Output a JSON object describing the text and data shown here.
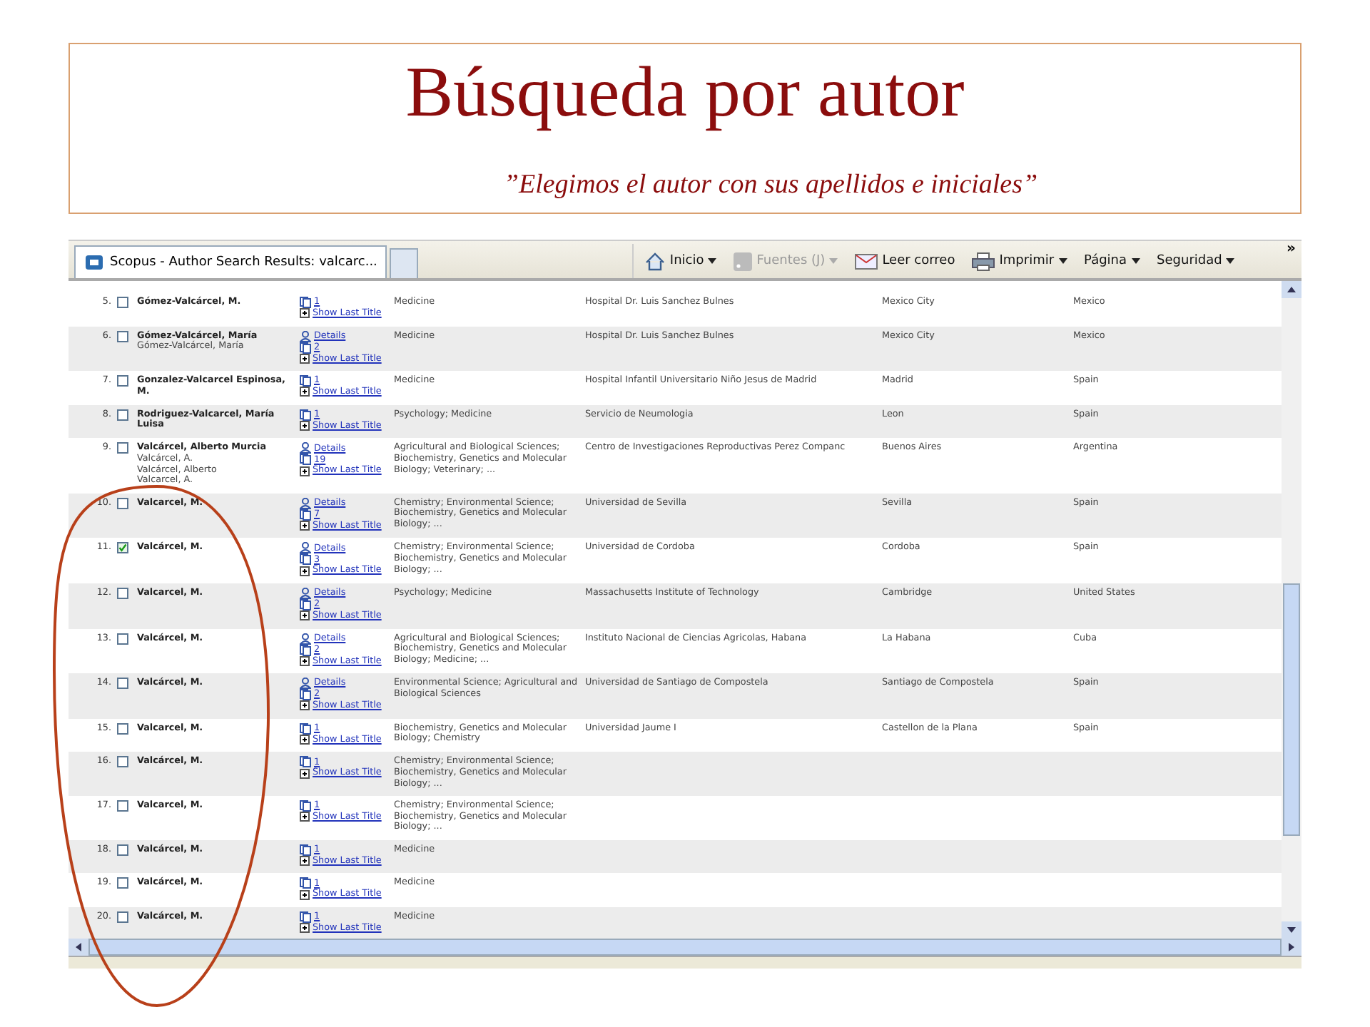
{
  "slide": {
    "title": "Búsqueda por autor",
    "subtitle": "”Elegimos el autor con sus apellidos e iniciales”"
  },
  "browser": {
    "tab": "Scopus - Author Search Results: valcarc...",
    "toolbar": [
      {
        "label": "Inicio",
        "kind": "home",
        "dropdown": true,
        "disabled": false
      },
      {
        "label": "Fuentes (J)",
        "kind": "feed",
        "dropdown": true,
        "disabled": true
      },
      {
        "label": "Leer correo",
        "kind": "mail",
        "dropdown": false,
        "disabled": false
      },
      {
        "label": "Imprimir",
        "kind": "print",
        "dropdown": true,
        "disabled": false
      },
      {
        "label": "Página",
        "kind": "text",
        "dropdown": true,
        "disabled": false
      },
      {
        "label": "Seguridad",
        "kind": "text",
        "dropdown": true,
        "disabled": false
      }
    ],
    "overflow": "»"
  },
  "rows": [
    {
      "number": "5.",
      "checked": false,
      "name": "Gómez-Valcárcel, M.",
      "variants": [],
      "details": "",
      "documents": "1",
      "show_last_title": "Show Last Title",
      "subjects": "Medicine",
      "affiliation": "Hospital Dr. Luis Sanchez Bulnes",
      "city": "Mexico City",
      "country": "Mexico"
    },
    {
      "number": "6.",
      "checked": false,
      "name": "Gómez-Valcárcel, María",
      "variants": [
        "Gómez-Valcárcel, María"
      ],
      "details": "Details",
      "documents": "2",
      "show_last_title": "Show Last Title",
      "subjects": "Medicine",
      "affiliation": "Hospital Dr. Luis Sanchez Bulnes",
      "city": "Mexico City",
      "country": "Mexico"
    },
    {
      "number": "7.",
      "checked": false,
      "name": "Gonzalez-Valcarcel Espinosa, M.",
      "variants": [],
      "details": "",
      "documents": "1",
      "show_last_title": "Show Last Title",
      "subjects": "Medicine",
      "affiliation": "Hospital Infantil Universitario Niño Jesus de Madrid",
      "city": "Madrid",
      "country": "Spain"
    },
    {
      "number": "8.",
      "checked": false,
      "name": "Rodriguez-Valcarcel, María Luisa",
      "variants": [],
      "details": "",
      "documents": "1",
      "show_last_title": "Show Last Title",
      "subjects": "Psychology; Medicine",
      "affiliation": "Servicio de Neumologia",
      "city": "Leon",
      "country": "Spain"
    },
    {
      "number": "9.",
      "checked": false,
      "name": "Valcárcel, Alberto Murcia",
      "variants": [
        "Valcárcel, A.",
        "Valcárcel, Alberto",
        "Valcarcel, A."
      ],
      "details": "Details",
      "documents": "19",
      "show_last_title": "Show Last Title",
      "subjects": "Agricultural and Biological Sciences; Biochemistry, Genetics and Molecular Biology; Veterinary; ...",
      "affiliation": "Centro de Investigaciones Reproductivas Perez Companc",
      "city": "Buenos Aires",
      "country": "Argentina"
    },
    {
      "number": "10.",
      "checked": false,
      "name": "Valcarcel, M.",
      "variants": [],
      "details": "Details",
      "documents": "7",
      "show_last_title": "Show Last Title",
      "subjects": "Chemistry; Environmental Science; Biochemistry, Genetics and Molecular Biology; ...",
      "affiliation": "Universidad de Sevilla",
      "city": "Sevilla",
      "country": "Spain"
    },
    {
      "number": "11.",
      "checked": true,
      "name": "Valcárcel, M.",
      "variants": [],
      "details": "Details",
      "documents": "3",
      "show_last_title": "Show Last Title",
      "subjects": "Chemistry; Environmental Science; Biochemistry, Genetics and Molecular Biology; ...",
      "affiliation": "Universidad de Cordoba",
      "city": "Cordoba",
      "country": "Spain"
    },
    {
      "number": "12.",
      "checked": false,
      "name": "Valcarcel, M.",
      "variants": [],
      "details": "Details",
      "documents": "2",
      "show_last_title": "Show Last Title",
      "subjects": "Psychology; Medicine",
      "affiliation": "Massachusetts Institute of Technology",
      "city": "Cambridge",
      "country": "United States"
    },
    {
      "number": "13.",
      "checked": false,
      "name": "Valcárcel, M.",
      "variants": [],
      "details": "Details",
      "documents": "2",
      "show_last_title": "Show Last Title",
      "subjects": "Agricultural and Biological Sciences; Biochemistry, Genetics and Molecular Biology; Medicine; ...",
      "affiliation": "Instituto Nacional de Ciencias Agricolas, Habana",
      "city": "La Habana",
      "country": "Cuba"
    },
    {
      "number": "14.",
      "checked": false,
      "name": "Valcárcel, M.",
      "variants": [],
      "details": "Details",
      "documents": "2",
      "show_last_title": "Show Last Title",
      "subjects": "Environmental Science; Agricultural and Biological Sciences",
      "affiliation": "Universidad de Santiago de Compostela",
      "city": "Santiago de Compostela",
      "country": "Spain"
    },
    {
      "number": "15.",
      "checked": false,
      "name": "Valcarcel, M.",
      "variants": [],
      "details": "",
      "documents": "1",
      "show_last_title": "Show Last Title",
      "subjects": "Biochemistry, Genetics and Molecular Biology; Chemistry",
      "affiliation": "Universidad Jaume I",
      "city": "Castellon de la Plana",
      "country": "Spain"
    },
    {
      "number": "16.",
      "checked": false,
      "name": "Valcárcel, M.",
      "variants": [],
      "details": "",
      "documents": "1",
      "show_last_title": "Show Last Title",
      "subjects": "Chemistry; Environmental Science; Biochemistry, Genetics and Molecular Biology; ...",
      "affiliation": "",
      "city": "",
      "country": ""
    },
    {
      "number": "17.",
      "checked": false,
      "name": "Valcarcel, M.",
      "variants": [],
      "details": "",
      "documents": "1",
      "show_last_title": "Show Last Title",
      "subjects": "Chemistry; Environmental Science; Biochemistry, Genetics and Molecular Biology; ...",
      "affiliation": "",
      "city": "",
      "country": ""
    },
    {
      "number": "18.",
      "checked": false,
      "name": "Valcárcel, M.",
      "variants": [],
      "details": "",
      "documents": "1",
      "show_last_title": "Show Last Title",
      "subjects": "Medicine",
      "affiliation": "",
      "city": "",
      "country": ""
    },
    {
      "number": "19.",
      "checked": false,
      "name": "Valcárcel, M.",
      "variants": [],
      "details": "",
      "documents": "1",
      "show_last_title": "Show Last Title",
      "subjects": "Medicine",
      "affiliation": "",
      "city": "",
      "country": ""
    },
    {
      "number": "20.",
      "checked": false,
      "name": "Valcárcel, M.",
      "variants": [],
      "details": "",
      "documents": "1",
      "show_last_title": "Show Last Title",
      "subjects": "Medicine",
      "affiliation": "",
      "city": "",
      "country": ""
    }
  ]
}
